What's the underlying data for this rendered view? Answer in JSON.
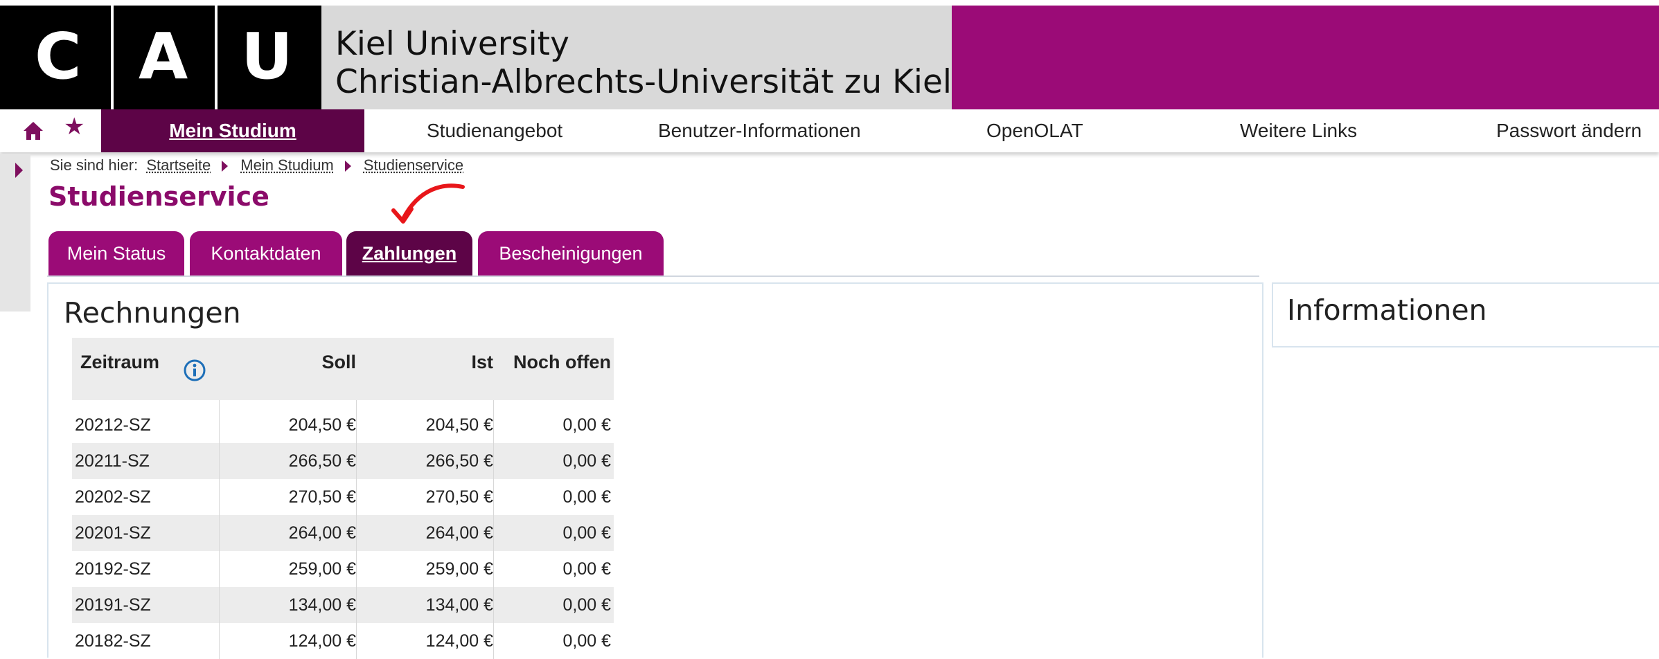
{
  "header": {
    "logo_letters": [
      "C",
      "A",
      "U"
    ],
    "university_line1": "Kiel University",
    "university_line2": "Christian-Albrechts-Universität zu Kiel",
    "colors": {
      "brand_magenta": "#9b0b77",
      "brand_dark": "#5d0447"
    }
  },
  "nav": {
    "home_icon": "home-icon",
    "star_icon": "star-icon",
    "items": [
      {
        "label": "Mein Studium",
        "active": true
      },
      {
        "label": "Studienangebot",
        "active": false
      },
      {
        "label": "Benutzer-Informationen",
        "active": false
      },
      {
        "label": "OpenOLAT",
        "active": false
      },
      {
        "label": "Weitere Links",
        "active": false
      },
      {
        "label": "Passwort ändern",
        "active": false
      }
    ]
  },
  "breadcrumb": {
    "prefix": "Sie sind hier:",
    "items": [
      "Startseite",
      "Mein Studium",
      "Studienservice"
    ]
  },
  "page": {
    "title": "Studienservice"
  },
  "tabs": [
    {
      "label": "Mein Status",
      "active": false
    },
    {
      "label": "Kontaktdaten",
      "active": false
    },
    {
      "label": "Zahlungen",
      "active": true
    },
    {
      "label": "Bescheinigungen",
      "active": false
    }
  ],
  "invoices": {
    "title": "Rechnungen",
    "columns": [
      "Zeitraum",
      "Soll",
      "Ist",
      "Noch offen"
    ],
    "rows": [
      {
        "zeitraum": "20212-SZ",
        "soll": "204,50 €",
        "ist": "204,50 €",
        "offen": "0,00 €"
      },
      {
        "zeitraum": "20211-SZ",
        "soll": "266,50 €",
        "ist": "266,50 €",
        "offen": "0,00 €"
      },
      {
        "zeitraum": "20202-SZ",
        "soll": "270,50 €",
        "ist": "270,50 €",
        "offen": "0,00 €"
      },
      {
        "zeitraum": "20201-SZ",
        "soll": "264,00 €",
        "ist": "264,00 €",
        "offen": "0,00 €"
      },
      {
        "zeitraum": "20192-SZ",
        "soll": "259,00 €",
        "ist": "259,00 €",
        "offen": "0,00 €"
      },
      {
        "zeitraum": "20191-SZ",
        "soll": "134,00 €",
        "ist": "134,00 €",
        "offen": "0,00 €"
      },
      {
        "zeitraum": "20182-SZ",
        "soll": "124,00 €",
        "ist": "124,00 €",
        "offen": "0,00 €"
      }
    ]
  },
  "info_panel": {
    "title": "Informationen"
  }
}
